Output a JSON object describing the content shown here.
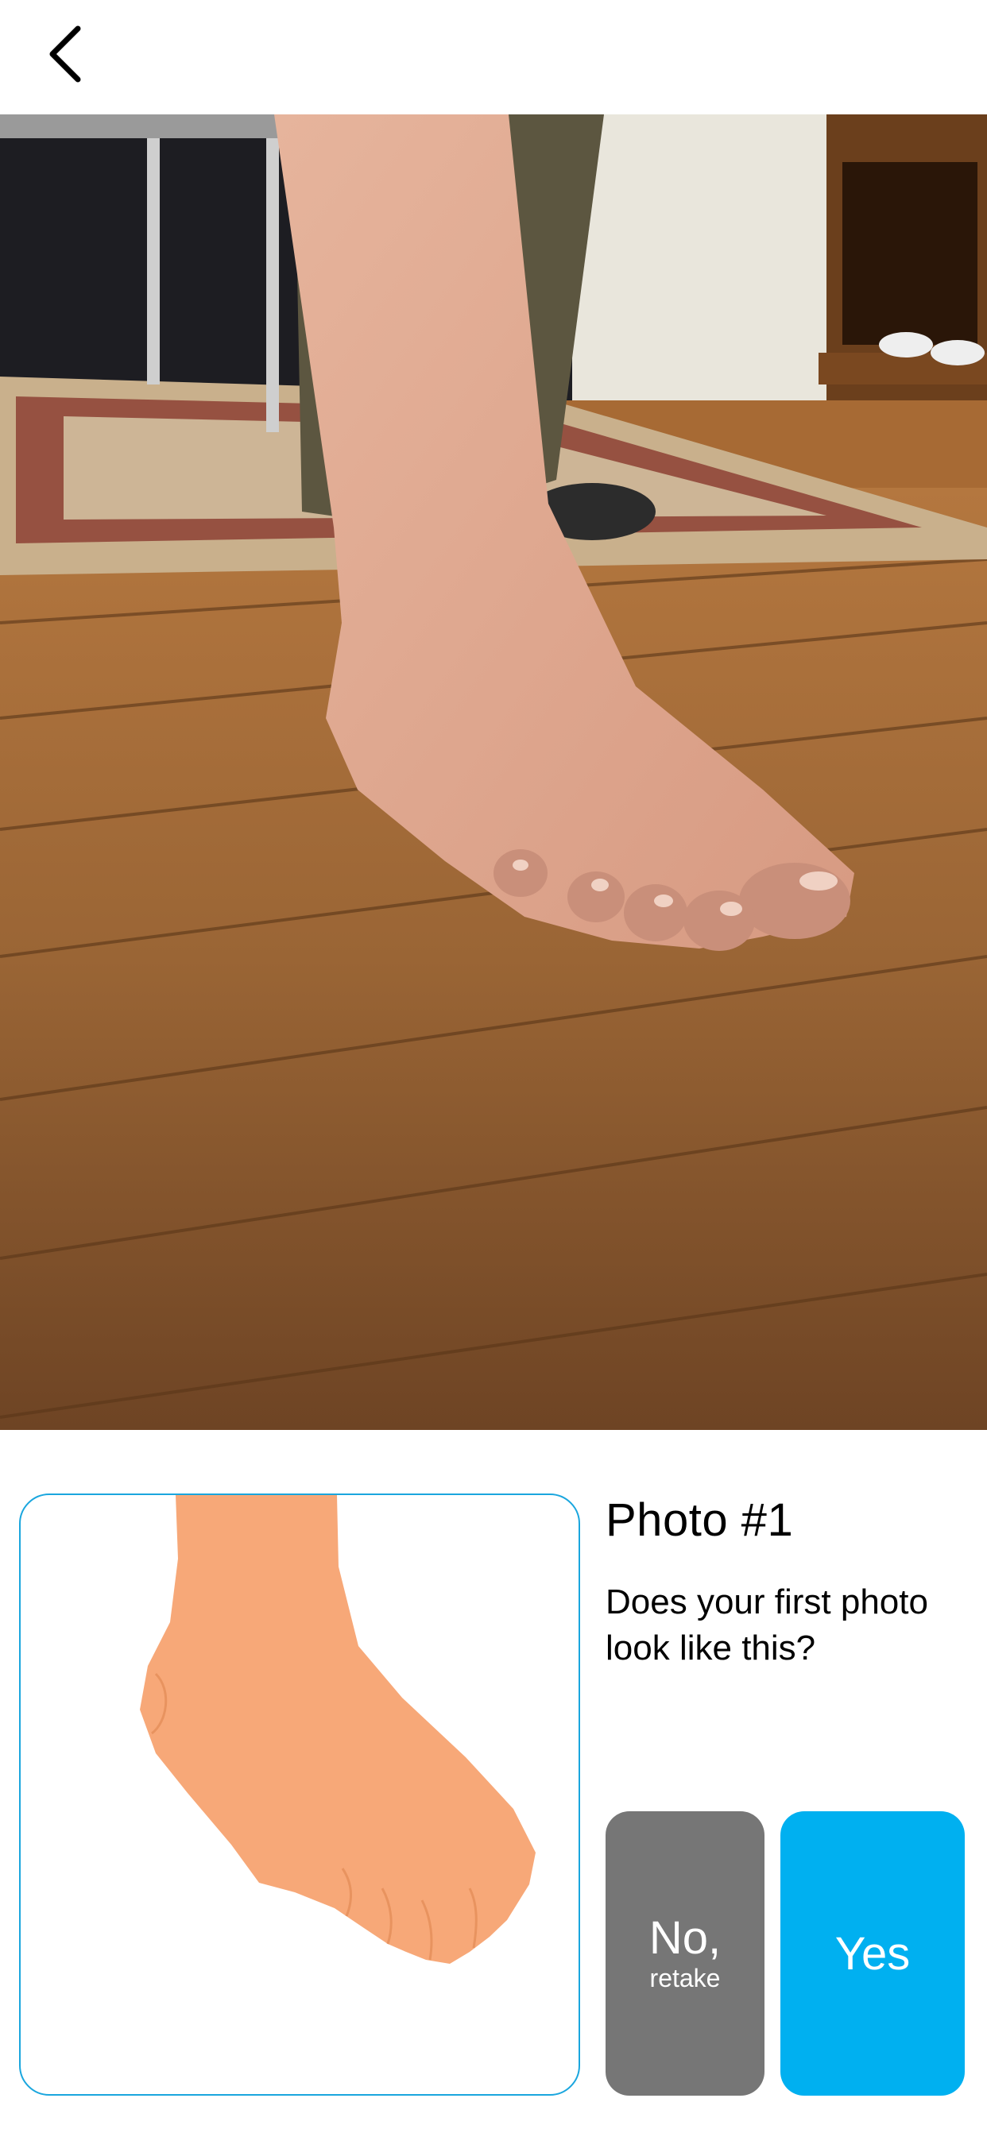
{
  "nav": {
    "back_icon": "chevron-left-icon"
  },
  "photo": {
    "description_icon": "captured-foot-photo"
  },
  "example": {
    "illustration_icon": "foot-illustration"
  },
  "content": {
    "title": "Photo #1",
    "question": "Does your first photo look like this?"
  },
  "buttons": {
    "no_label": "No,",
    "no_sub": "retake",
    "yes_label": "Yes"
  },
  "colors": {
    "accent": "#00b0f0",
    "secondary": "#767676",
    "border": "#1aa6de",
    "skin": "#f7a878"
  }
}
